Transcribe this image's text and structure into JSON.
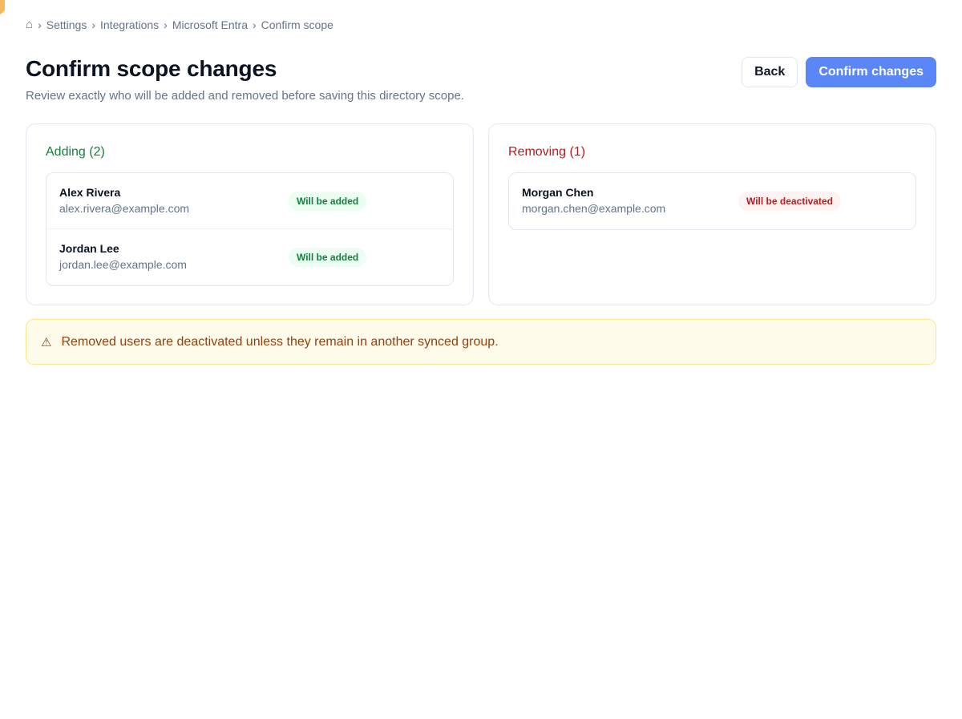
{
  "breadcrumb": {
    "home_icon": "⌂",
    "separator": "›",
    "items": [
      "Settings",
      "Integrations",
      "Microsoft Entra",
      "Confirm scope"
    ]
  },
  "header": {
    "title": "Confirm scope changes",
    "subtitle": "Review exactly who will be added and removed before saving this directory scope."
  },
  "actions": {
    "back_label": "Back",
    "confirm_label": "Confirm changes"
  },
  "adding": {
    "title": "Adding (2)",
    "users": [
      {
        "name": "Alex Rivera",
        "email": "alex.rivera@example.com",
        "status": "Will be added"
      },
      {
        "name": "Jordan Lee",
        "email": "jordan.lee@example.com",
        "status": "Will be added"
      }
    ]
  },
  "removing": {
    "title": "Removing (1)",
    "users": [
      {
        "name": "Morgan Chen",
        "email": "morgan.chen@example.com",
        "status": "Will be deactivated"
      }
    ]
  },
  "alert": {
    "icon": "⚠",
    "message": "Removed users are deactivated unless they remain in another synced group."
  },
  "colors": {
    "accent": "#5b86f7",
    "add": "#15803d",
    "remove": "#b91c1c",
    "warning": "#92400e"
  }
}
